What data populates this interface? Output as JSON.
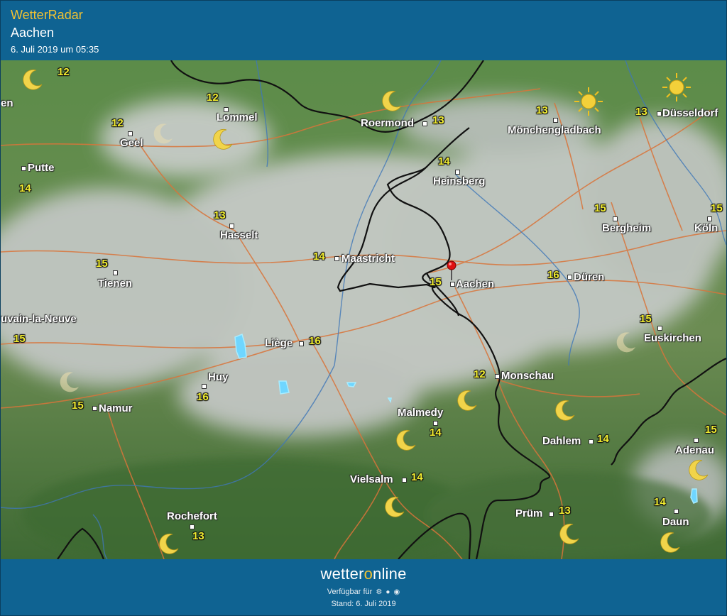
{
  "header": {
    "app_title": "WetterRadar",
    "location": "Aachen",
    "datetime": "6. Juli 2019 um 05:35"
  },
  "map": {
    "cities": [
      {
        "name": "Lommel",
        "temp": "12"
      },
      {
        "name": "Geel",
        "temp": "12"
      },
      {
        "name": "Putte",
        "temp": "14"
      },
      {
        "name": "Hasselt",
        "temp": "13"
      },
      {
        "name": "Tienen",
        "temp": "15"
      },
      {
        "name": "Roermond",
        "temp": "13"
      },
      {
        "name": "Heinsberg",
        "temp": "14"
      },
      {
        "name": "Mönchengladbach",
        "temp": "13"
      },
      {
        "name": "Düsseldorf",
        "temp": "13"
      },
      {
        "name": "Maastricht",
        "temp": "14"
      },
      {
        "name": "Aachen",
        "temp": "15"
      },
      {
        "name": "Düren",
        "temp": "16"
      },
      {
        "name": "Bergheim",
        "temp": "15"
      },
      {
        "name": "Köln",
        "temp": "15"
      },
      {
        "name": "Liège",
        "temp": "16"
      },
      {
        "name": "Euskirchen",
        "temp": "15"
      },
      {
        "name": "Huy",
        "temp": "16"
      },
      {
        "name": "Namur",
        "temp": "15"
      },
      {
        "name": "Monschau",
        "temp": "12"
      },
      {
        "name": "Malmedy",
        "temp": "14"
      },
      {
        "name": "Dahlem",
        "temp": "14"
      },
      {
        "name": "Adenau",
        "temp": "15"
      },
      {
        "name": "Vielsalm",
        "temp": "14"
      },
      {
        "name": "Prüm",
        "temp": "13"
      },
      {
        "name": "Daun",
        "temp": "14"
      },
      {
        "name": "Rochefort",
        "temp": "13"
      }
    ],
    "edge_labels": {
      "left_top": "en",
      "left_mid": "uvain-la-Neuve",
      "left_mid_temp": "15",
      "top_temp": "12"
    },
    "colors": {
      "temperature": "#f2ee2f",
      "pin": "#e01010",
      "rain": "#6fd6ff"
    },
    "icons": [
      "moon-icon",
      "sun-icon",
      "location-pin-icon"
    ]
  },
  "footer": {
    "brand_prefix": "wetter",
    "brand_o": "o",
    "brand_suffix": "nline",
    "availability": "Verfügbar für",
    "stand": "Stand: 6. Juli 2019"
  }
}
